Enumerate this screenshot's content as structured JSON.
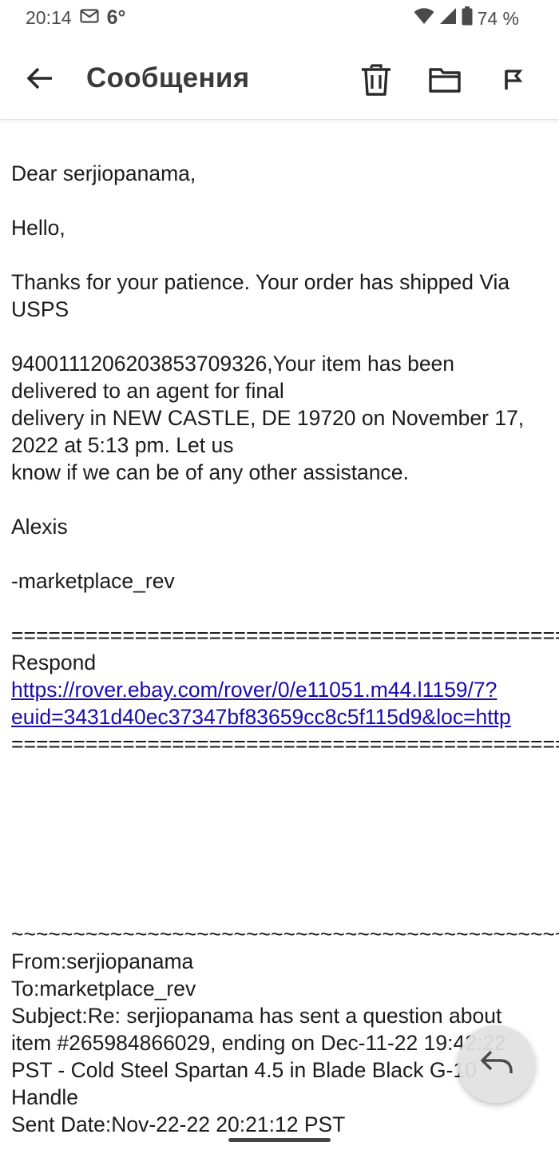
{
  "status_bar": {
    "time": "20:14",
    "temperature": "6°",
    "battery": "74 %",
    "icons": [
      "mail-icon",
      "wifi-icon",
      "cell-signal-icon",
      "battery-icon"
    ]
  },
  "app_bar": {
    "title": "Сообщения",
    "back_icon": "arrow-left-icon",
    "actions": [
      "trash-icon",
      "folder-icon",
      "flag-icon"
    ]
  },
  "message": {
    "greeting": "Dear serjiopanama,",
    "hello": "Hello,",
    "line1": "Thanks for your patience. Your order has shipped Via",
    "line2": "USPS",
    "line3": "9400111206203853709326,Your item has been",
    "line4": "delivered to an agent for final",
    "line5": "delivery in NEW CASTLE, DE 19720 on November 17,",
    "line6": "2022 at 5:13 pm. Let us",
    "line7": "know if we can be of any other assistance.",
    "signature": "Alexis",
    "sender_handle": "-marketplace_rev",
    "separator": "============================================================",
    "respond_label": "Respond",
    "respond_link_line1": "https://rover.ebay.com/rover/0/e11051.m44.l1159/7?",
    "respond_link_line2": "euid=3431d40ec37347bf83659cc8c5f115d9&loc=http",
    "tilde_separator": "~~~~~~~~~~~~~~~~~~~~~~~~~~~~~~~~~~~~~~~~~~~~~~~~~~~~",
    "from": "From:serjiopanama",
    "to": "To:marketplace_rev",
    "subject_line1": "Subject:Re: serjiopanama has sent a question about",
    "subject_line2": "item #265984866029, ending on Dec-11-22 19:42:22",
    "subject_line3": "PST - Cold Steel Spartan 4.5 in Blade Black G-10",
    "subject_line4": "Handle",
    "sent_date": "Sent Date:Nov-22-22 20:21:12 PST"
  },
  "fab": {
    "icon": "reply-icon"
  },
  "colors": {
    "link": "#1a0dab",
    "text": "#1c1c1c",
    "title": "#3a3a3a"
  }
}
